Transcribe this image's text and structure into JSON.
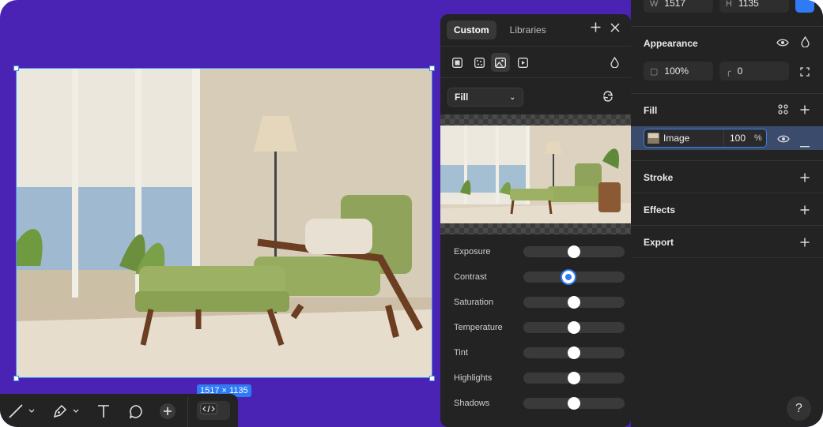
{
  "canvas": {
    "size_label": "1517 × 1135",
    "background": "#4a22b4",
    "selection_color": "#3a8bff"
  },
  "toolbar": {
    "tools": [
      "line-icon",
      "pen-icon",
      "text-icon",
      "comment-icon",
      "add-icon",
      "code-icon"
    ]
  },
  "fill_panel": {
    "tabs": [
      {
        "label": "Custom",
        "active": true
      },
      {
        "label": "Libraries",
        "active": false
      }
    ],
    "fill_type": "Fill",
    "adjustments": [
      {
        "label": "Exposure",
        "value": 0.5
      },
      {
        "label": "Contrast",
        "value": 0.44
      },
      {
        "label": "Saturation",
        "value": 0.5
      },
      {
        "label": "Temperature",
        "value": 0.5
      },
      {
        "label": "Tint",
        "value": 0.5
      },
      {
        "label": "Highlights",
        "value": 0.5
      },
      {
        "label": "Shadows",
        "value": 0.5
      }
    ]
  },
  "props": {
    "width_label": "W",
    "width_value": "1517",
    "height_label": "H",
    "height_value": "1135",
    "appearance_title": "Appearance",
    "opacity_value": "100%",
    "radius_value": "0",
    "fill_title": "Fill",
    "fill_item": {
      "name": "Image",
      "opacity": "100",
      "unit": "%"
    },
    "stroke_title": "Stroke",
    "effects_title": "Effects",
    "export_title": "Export",
    "help_label": "?"
  }
}
